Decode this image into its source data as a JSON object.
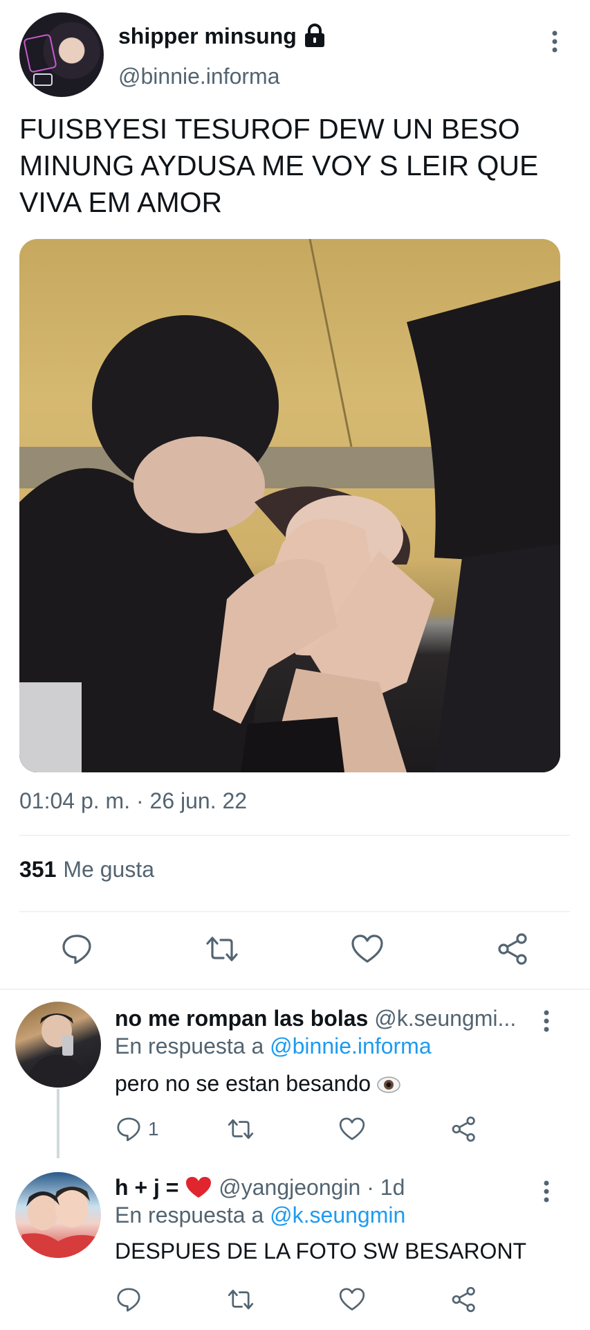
{
  "tweet": {
    "display_name": "shipper minsung",
    "username": "@binnie.informa",
    "text": "FUISBYESI TESUROF DEW UN BESO MINUNG AYDUSA ME VOY S LEIR QUE VIVA EM AMOR",
    "timestamp": "01:04 p. m. · 26 jun. 22",
    "likes_count": "351",
    "likes_label": "Me gusta",
    "icons": {
      "lock": "lock-icon",
      "more": "more-vertical-icon",
      "reply": "reply-icon",
      "retweet": "retweet-icon",
      "like": "heart-icon",
      "share": "share-icon"
    }
  },
  "replies": [
    {
      "display_name": "no me rompan las bolas",
      "handle_time": "@k.seungmi...",
      "reply_prefix": "En respuesta a",
      "reply_mention": "@binnie.informa",
      "text": "pero no se estan besando",
      "emoji": "eye-emoji",
      "reply_count": "1"
    },
    {
      "display_name": "h + j =",
      "emoji": "red-heart-emoji",
      "handle_time": "@yangjeongin · 1d",
      "reply_prefix": "En respuesta a",
      "reply_mention": "@k.seungmin",
      "text": "DESPUES DE LA FOTO SW BESARONT",
      "reply_count": ""
    }
  ],
  "colors": {
    "text": "#0f1419",
    "secondary": "#536471",
    "link": "#1d9bf0",
    "divider": "#eff3f4"
  }
}
